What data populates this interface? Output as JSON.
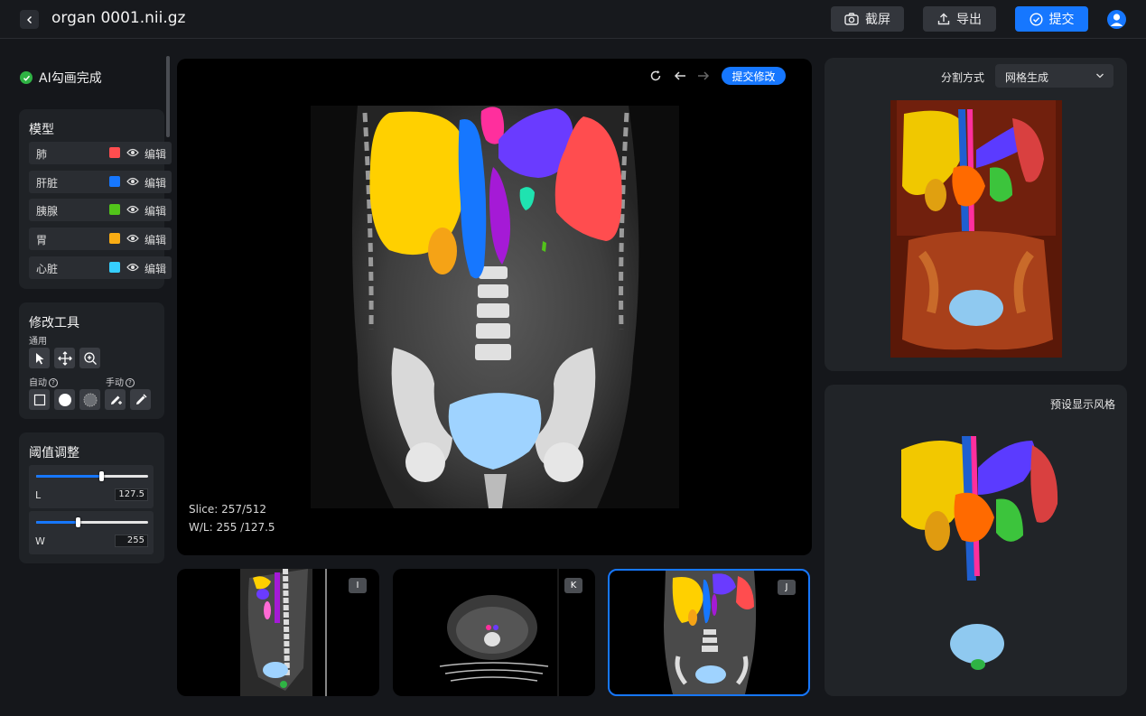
{
  "header": {
    "file_name": "organ 0001.nii.gz",
    "screenshot_label": "截屏",
    "export_label": "导出",
    "submit_label": "提交"
  },
  "left_panel": {
    "ai_status": "AI勾画完成",
    "model": {
      "title": "模型",
      "edit_label": "编辑",
      "items": [
        {
          "name": "肺",
          "color": "#ff4d4f"
        },
        {
          "name": "肝脏",
          "color": "#1677ff"
        },
        {
          "name": "胰腺",
          "color": "#52c41a"
        },
        {
          "name": "胃",
          "color": "#faad14"
        },
        {
          "name": "心脏",
          "color": "#36cfff"
        }
      ]
    },
    "tools": {
      "title": "修改工具",
      "general_label": "通用",
      "auto_label": "自动",
      "manual_label": "手动"
    },
    "threshold": {
      "title": "阈值调整",
      "sliders": [
        {
          "name": "L",
          "value": "127.5",
          "fraction": 0.58
        },
        {
          "name": "W",
          "value": "255",
          "fraction": 0.37
        }
      ]
    }
  },
  "viewer": {
    "submit_edit_label": "提交修改",
    "slice": "Slice: 257/512",
    "wl": "W/L: 255 /127.5"
  },
  "thumbnails": [
    {
      "badge": "I",
      "active": false
    },
    {
      "badge": "K",
      "active": false
    },
    {
      "badge": "J",
      "active": true
    }
  ],
  "right_panel": {
    "seg_method_label": "分割方式",
    "seg_method_value": "网格生成",
    "preset_style_label": "预设显示风格"
  },
  "colors": {
    "accent": "#1677ff",
    "success": "#2fb344"
  }
}
